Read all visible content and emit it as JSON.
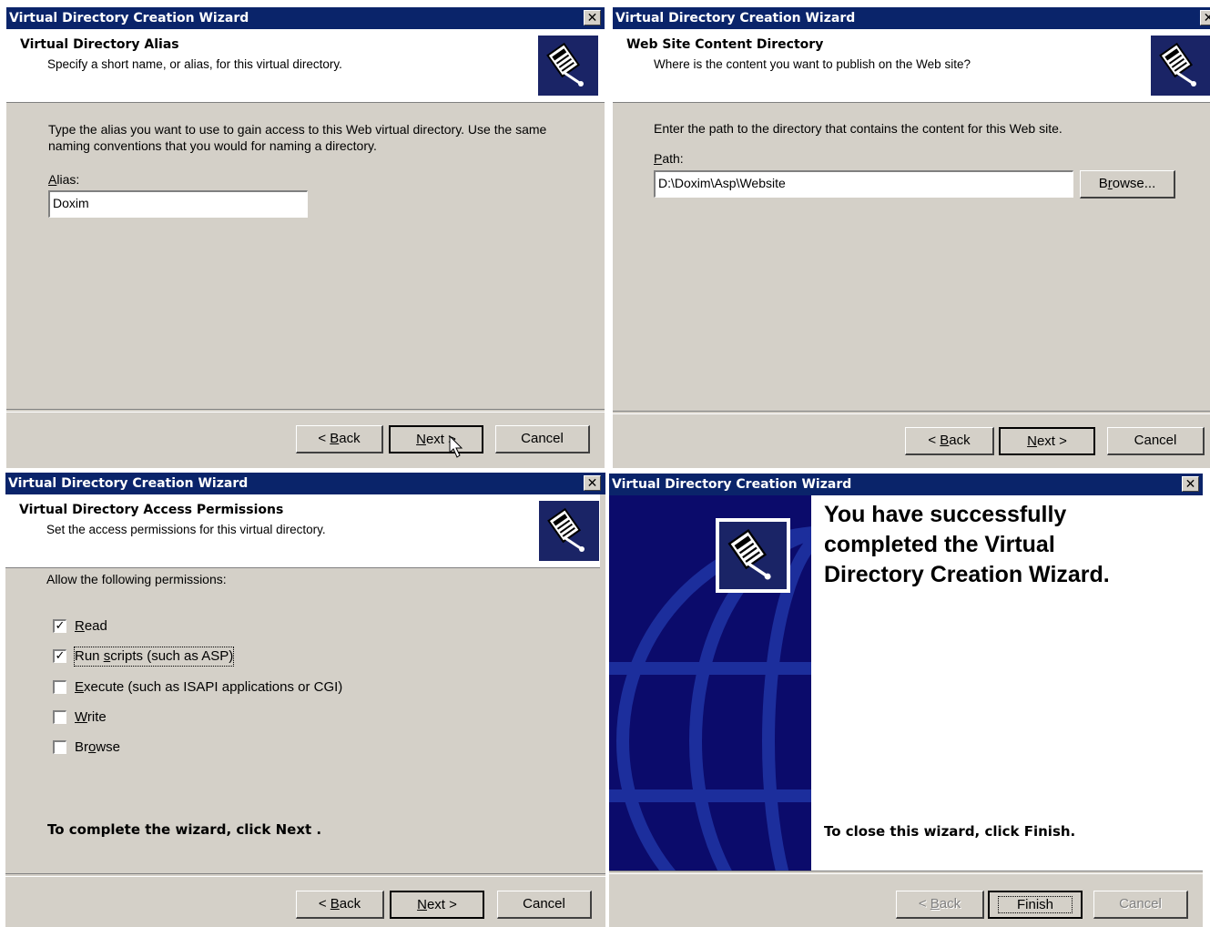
{
  "window_title": "Virtual Directory Creation Wizard",
  "close_glyph": "✕",
  "icons": {
    "wizard_logo": "book-stack-icon",
    "close": "close-icon",
    "mouse_cursor": "arrow-cursor-icon"
  },
  "colors": {
    "title_bar": "#0a246a",
    "dialog_face": "#d4d0c8",
    "welcome_panel": "#0b0b6b",
    "globe": "#1c2e9c"
  },
  "alias_step": {
    "header_title": "Virtual Directory Alias",
    "header_subtitle": "Specify a short name, or alias, for this virtual directory.",
    "instructions": "Type the alias you want to use to gain access to this Web virtual directory. Use the same naming conventions that you would for naming a directory.",
    "alias_label_key": "A",
    "alias_label_rest": "lias:",
    "alias_value": "Doxim",
    "buttons": {
      "back_prefix": "< ",
      "back_key": "B",
      "back_rest": "ack",
      "next_key": "N",
      "next_rest": "ext >",
      "cancel": "Cancel"
    }
  },
  "content_step": {
    "header_title": "Web Site Content Directory",
    "header_subtitle": "Where is the content you want to publish on the Web site?",
    "instructions": "Enter the path to the directory that contains the content for this Web site.",
    "path_label_key": "P",
    "path_label_rest": "ath:",
    "path_value": "D:\\Doxim\\Asp\\Website",
    "browse_pre": "B",
    "browse_key": "r",
    "browse_rest": "owse...",
    "buttons": {
      "back_prefix": "< ",
      "back_key": "B",
      "back_rest": "ack",
      "next_key": "N",
      "next_rest": "ext >",
      "cancel": "Cancel"
    }
  },
  "permissions_step": {
    "header_title": "Virtual Directory Access Permissions",
    "header_subtitle": "Set the access permissions for this virtual directory.",
    "allow_label": "Allow the following permissions:",
    "permissions": [
      {
        "key": "R",
        "rest": "ead",
        "checked": true
      },
      {
        "pre": "Run ",
        "key": "s",
        "rest": "cripts (such as ASP)",
        "checked": true
      },
      {
        "key": "E",
        "rest": "xecute (such as ISAPI applications or CGI)",
        "checked": false
      },
      {
        "key": "W",
        "rest": "rite",
        "checked": false
      },
      {
        "pre": "Br",
        "key": "o",
        "rest": "wse",
        "checked": false
      }
    ],
    "complete_text": "To complete the wizard, click Next .",
    "buttons": {
      "back_prefix": "< ",
      "back_key": "B",
      "back_rest": "ack",
      "next_key": "N",
      "next_rest": "ext >",
      "cancel": "Cancel"
    }
  },
  "finish_step": {
    "success_message": "You have successfully completed the Virtual Directory Creation Wizard.",
    "close_text": "To close this wizard, click Finish.",
    "buttons": {
      "back_prefix": "< ",
      "back_key": "B",
      "back_rest": "ack",
      "finish": "Finish",
      "cancel": "Cancel"
    }
  }
}
